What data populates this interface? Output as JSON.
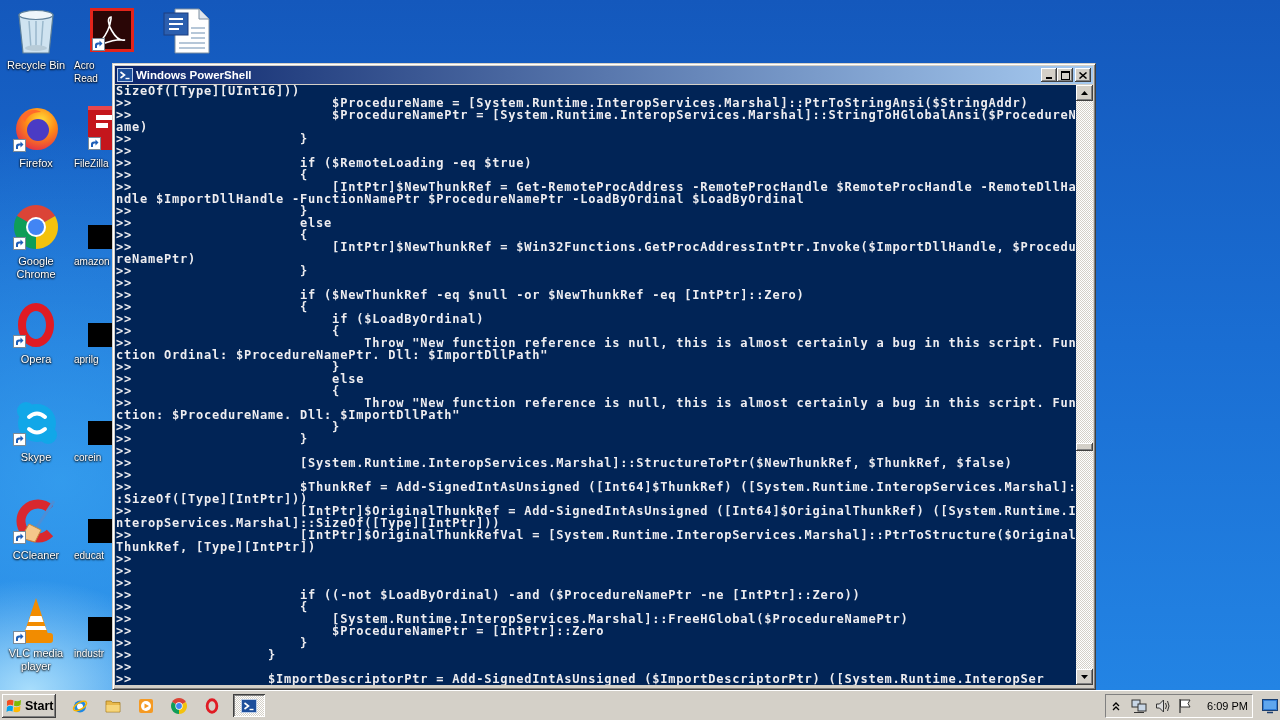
{
  "desktop": {
    "icon_columns": [
      [
        {
          "kind": "bin",
          "label": "Recycle Bin",
          "selected": false
        },
        {
          "kind": "firefox",
          "label": "Firefox",
          "selected": false
        },
        {
          "kind": "chrome",
          "label": "Google Chrome",
          "selected": false
        },
        {
          "kind": "opera",
          "label": "Opera",
          "selected": false
        },
        {
          "kind": "skype",
          "label": "Skype",
          "selected": false
        },
        {
          "kind": "ccleaner",
          "label": "CCleaner",
          "selected": false
        },
        {
          "kind": "vlc",
          "label": "VLC media player",
          "selected": false
        }
      ],
      [
        {
          "kind": "acrobat",
          "label": "Acro Read",
          "selected": false
        },
        {
          "kind": "filezilla",
          "label": "FileZilla",
          "selected": false
        },
        {
          "kind": "thumbnail",
          "label": "amazon",
          "selected": false
        },
        {
          "kind": "thumbnail",
          "label": "aprilg",
          "selected": false
        },
        {
          "kind": "thumbnail",
          "label": "corein",
          "selected": false
        },
        {
          "kind": "thumbnail",
          "label": "educat",
          "selected": false
        },
        {
          "kind": "thumbnail",
          "label": "industr",
          "selected": false
        }
      ],
      [
        {
          "kind": "document",
          "selected": false
        }
      ]
    ]
  },
  "window": {
    "title": "Windows PowerShell",
    "active": true,
    "console_lines": [
      "SizeOf([Type][UInt16]))",
      ">>                         $ProcedureName = [System.Runtime.InteropServices.Marshal]::PtrToStringAnsi($StringAddr)",
      ">>                         $ProcedureNamePtr = [System.Runtime.InteropServices.Marshal]::StringToHGlobalAnsi($ProcedureN",
      "ame)",
      ">>                     }",
      ">>",
      ">>                     if ($RemoteLoading -eq $true)",
      ">>                     {",
      ">>                         [IntPtr]$NewThunkRef = Get-RemoteProcAddress -RemoteProcHandle $RemoteProcHandle -RemoteDllHa",
      "ndle $ImportDllHandle -FunctionNamePtr $ProcedureNamePtr -LoadByOrdinal $LoadByOrdinal",
      ">>                     }",
      ">>                     else",
      ">>                     {",
      ">>                         [IntPtr]$NewThunkRef = $Win32Functions.GetProcAddressIntPtr.Invoke($ImportDllHandle, $Procedu",
      "reNamePtr)",
      ">>                     }",
      ">>",
      ">>                     if ($NewThunkRef -eq $null -or $NewThunkRef -eq [IntPtr]::Zero)",
      ">>                     {",
      ">>                         if ($LoadByOrdinal)",
      ">>                         {",
      ">>                             Throw \"New function reference is null, this is almost certainly a bug in this script. Fun",
      "ction Ordinal: $ProcedureNamePtr. Dll: $ImportDllPath\"",
      ">>                         }",
      ">>                         else",
      ">>                         {",
      ">>                             Throw \"New function reference is null, this is almost certainly a bug in this script. Fun",
      "ction: $ProcedureName. Dll: $ImportDllPath\"",
      ">>                         }",
      ">>                     }",
      ">>",
      ">>                     [System.Runtime.InteropServices.Marshal]::StructureToPtr($NewThunkRef, $ThunkRef, $false)",
      ">>",
      ">>                     $ThunkRef = Add-SignedIntAsUnsigned ([Int64]$ThunkRef) ([System.Runtime.InteropServices.Marshal]:",
      ":SizeOf([Type][IntPtr]))",
      ">>                     [IntPtr]$OriginalThunkRef = Add-SignedIntAsUnsigned ([Int64]$OriginalThunkRef) ([System.Runtime.I",
      "nteropServices.Marshal]::SizeOf([Type][IntPtr]))",
      ">>                     [IntPtr]$OriginalThunkRefVal = [System.Runtime.InteropServices.Marshal]::PtrToStructure($Original",
      "ThunkRef, [Type][IntPtr])",
      ">>",
      ">>",
      ">>",
      ">>                     if ((-not $LoadByOrdinal) -and ($ProcedureNamePtr -ne [IntPtr]::Zero))",
      ">>                     {",
      ">>                         [System.Runtime.InteropServices.Marshal]::FreeHGlobal($ProcedureNamePtr)",
      ">>                         $ProcedureNamePtr = [IntPtr]::Zero",
      ">>                     }",
      ">>                 }",
      ">>",
      ">>                 $ImportDescriptorPtr = Add-SignedIntAsUnsigned ($ImportDescriptorPtr) ([System.Runtime.InteropSer"
    ]
  },
  "taskbar": {
    "start": "Start",
    "clock": "6:09 PM"
  }
}
